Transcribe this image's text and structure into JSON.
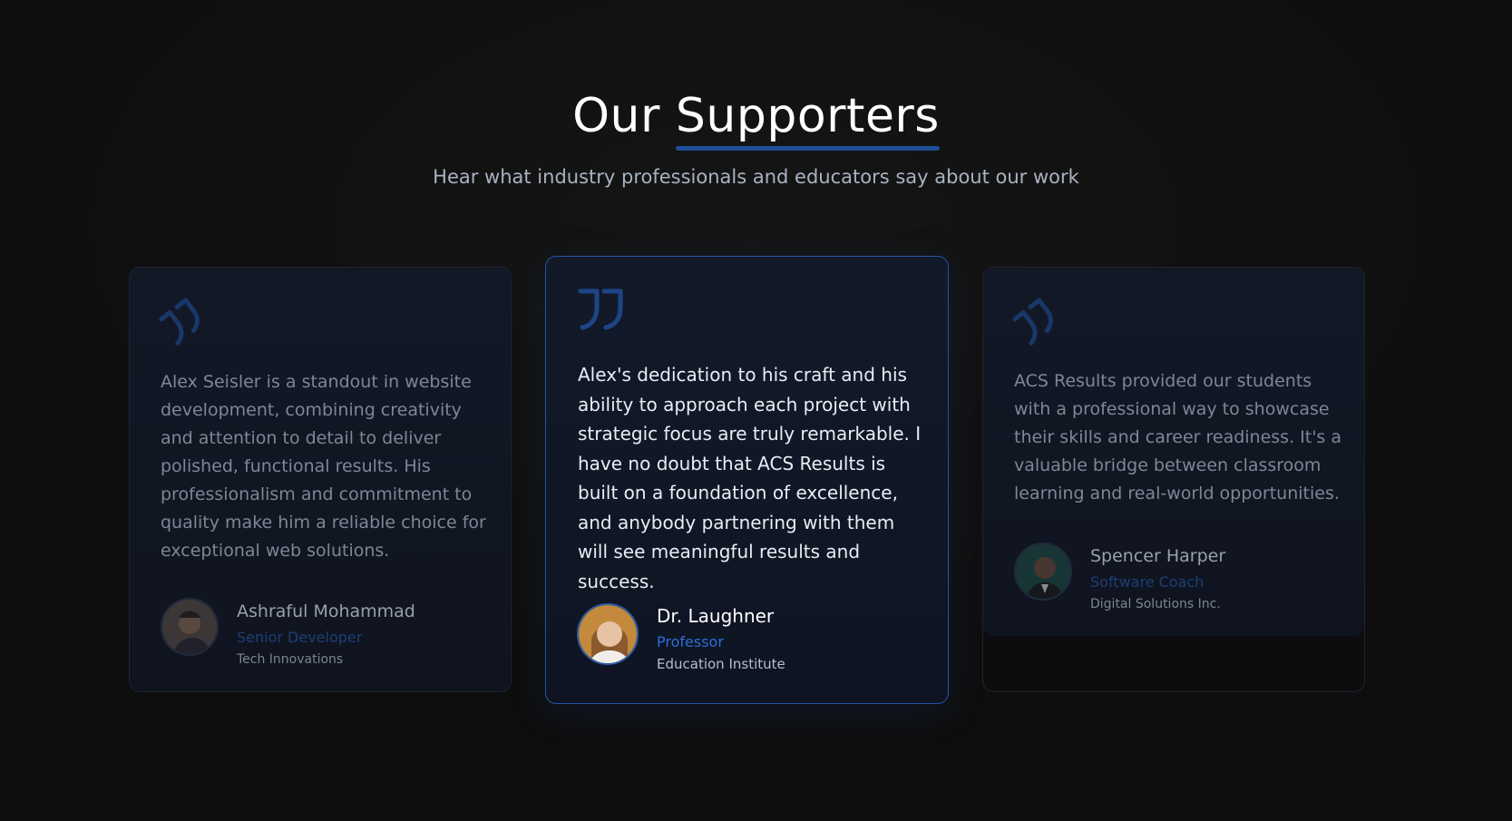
{
  "heading": {
    "title_part1": "Our",
    "title_highlight": "Supporters",
    "subtitle": "Hear what industry professionals and educators say about our work"
  },
  "testimonials": [
    {
      "text": "Alex Seisler is a standout in website development, combining creativity and attention to detail to deliver polished, functional results. His professionalism and commitment to quality make him a reliable choice for exceptional web solutions.",
      "name": "Ashraful Mohammad",
      "role": "Senior Developer",
      "org": "Tech Innovations",
      "icon": "quote-icon"
    },
    {
      "text": "Alex's dedication to his craft and his ability to approach each project with strategic focus are truly remarkable. I have no doubt that ACS Results is built on a foundation of excellence, and anybody partnering with them will see meaningful results and success.",
      "name": "Dr. Laughner",
      "role": "Professor",
      "org": "Education Institute",
      "icon": "quote-icon"
    },
    {
      "text": "ACS Results provided our students with a professional way to showcase their skills and career readiness. It's a valuable bridge between classroom learning and real-world opportunities.",
      "name": "Spencer Harper",
      "role": "Software Coach",
      "org": "Digital Solutions Inc.",
      "icon": "quote-icon"
    }
  ],
  "colors": {
    "accent": "#2b6fd6",
    "underline": "#1e4f96",
    "background": "#0e0e0e",
    "card_border_active": "#2554a0"
  }
}
